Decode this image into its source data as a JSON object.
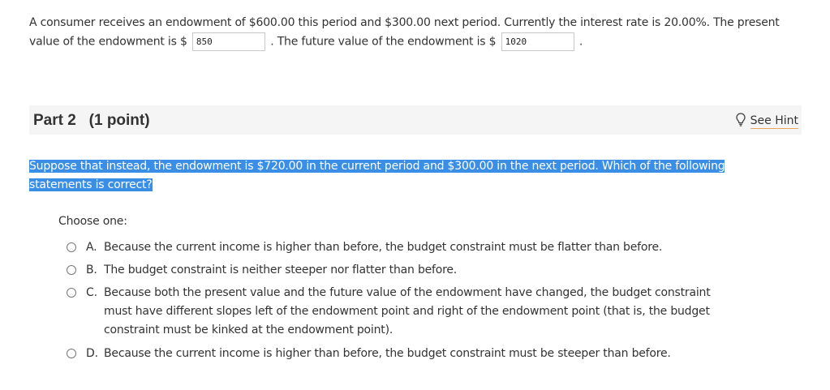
{
  "part1": {
    "text_before": "A consumer receives an endowment of $600.00 this period and $300.00 next period. Currently the interest rate is 20.00%. The present value of the endowment is $",
    "present_value_answer": "850",
    "text_middle": ". The future value of the endowment is $",
    "future_value_answer": "1020",
    "text_after": "."
  },
  "part2": {
    "title": "Part 2   (1 point)",
    "hint_label": "See Hint",
    "hint_icon": "lightbulb-icon",
    "question": "Suppose that instead, the endowment is $720.00 in the current period and $300.00 in the next period. Which of the following statements is correct?",
    "choose_label": "Choose one:",
    "options": [
      {
        "letter": "A.",
        "text": "Because the current income is higher than before, the budget constraint must be flatter than before."
      },
      {
        "letter": "B.",
        "text": "The budget constraint is neither steeper nor flatter than before."
      },
      {
        "letter": "C.",
        "text": "Because both the present value and the future value of the endowment have changed, the budget constraint must have different slopes left of the endowment point and right of the endowment point (that is, the budget constraint must be kinked at the endowment point)."
      },
      {
        "letter": "D.",
        "text": "Because the current income is higher than before, the budget constraint must be steeper than before."
      }
    ]
  },
  "colors": {
    "highlight": "#3b8ee6",
    "hint_underline": "#e7a65b",
    "part_bar": "#f5f5f5"
  }
}
